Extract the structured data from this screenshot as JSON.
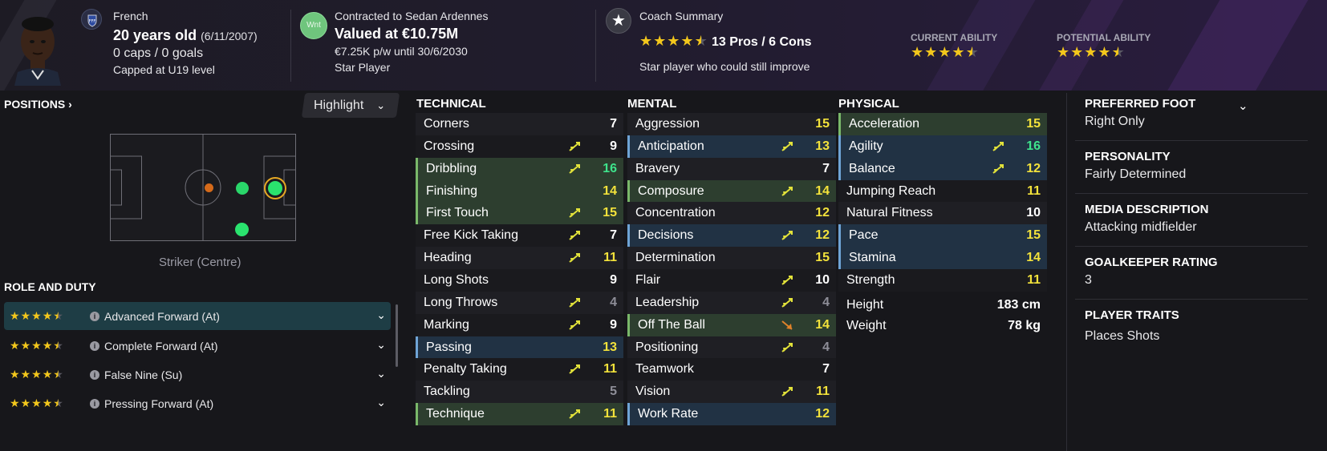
{
  "header": {
    "nationality": "French",
    "age_text": "20 years old",
    "dob": "(6/11/2007)",
    "caps_goals": "0 caps / 0 goals",
    "capped_level": "Capped at U19 level",
    "wnt_badge": "Wnt",
    "contract": "Contracted to Sedan Ardennes",
    "value": "Valued at €10.75M",
    "wage": "€7.25K p/w until 30/6/2030",
    "status": "Star Player",
    "coach_title": "Coach Summary",
    "pros_cons": "13 Pros / 6 Cons",
    "coach_stars": 4.5,
    "coach_note": "Star player who could still improve",
    "current_ability_label": "CURRENT ABILITY",
    "current_ability_stars": 4.5,
    "potential_ability_label": "POTENTIAL ABILITY",
    "potential_ability_stars": 4.5
  },
  "positions": {
    "title": "POSITIONS",
    "highlight_label": "Highlight",
    "position_name": "Striker (Centre)"
  },
  "role_duty": {
    "title": "ROLE AND DUTY",
    "roles": [
      {
        "label": "Advanced Forward (At)",
        "stars": 4.5
      },
      {
        "label": "Complete Forward (At)",
        "stars": 4.5
      },
      {
        "label": "False Nine (Su)",
        "stars": 4.5
      },
      {
        "label": "Pressing Forward (At)",
        "stars": 4.5
      }
    ]
  },
  "technical": {
    "title": "TECHNICAL",
    "attributes": [
      {
        "name": "Corners",
        "value": "7",
        "hl": "",
        "color": "white",
        "arrow": ""
      },
      {
        "name": "Crossing",
        "value": "9",
        "hl": "",
        "color": "white",
        "arrow": "up"
      },
      {
        "name": "Dribbling",
        "value": "16",
        "hl": "green",
        "color": "green",
        "arrow": "up"
      },
      {
        "name": "Finishing",
        "value": "14",
        "hl": "green",
        "color": "yellow",
        "arrow": ""
      },
      {
        "name": "First Touch",
        "value": "15",
        "hl": "green",
        "color": "yellow",
        "arrow": "up"
      },
      {
        "name": "Free Kick Taking",
        "value": "7",
        "hl": "",
        "color": "white",
        "arrow": "up"
      },
      {
        "name": "Heading",
        "value": "11",
        "hl": "",
        "color": "yellow",
        "arrow": "up"
      },
      {
        "name": "Long Shots",
        "value": "9",
        "hl": "",
        "color": "white",
        "arrow": ""
      },
      {
        "name": "Long Throws",
        "value": "4",
        "hl": "",
        "color": "grey",
        "arrow": "up"
      },
      {
        "name": "Marking",
        "value": "9",
        "hl": "",
        "color": "white",
        "arrow": "up"
      },
      {
        "name": "Passing",
        "value": "13",
        "hl": "blue",
        "color": "yellow",
        "arrow": ""
      },
      {
        "name": "Penalty Taking",
        "value": "11",
        "hl": "",
        "color": "yellow",
        "arrow": "up"
      },
      {
        "name": "Tackling",
        "value": "5",
        "hl": "",
        "color": "grey",
        "arrow": ""
      },
      {
        "name": "Technique",
        "value": "11",
        "hl": "green",
        "color": "yellow",
        "arrow": "up"
      }
    ]
  },
  "mental": {
    "title": "MENTAL",
    "attributes": [
      {
        "name": "Aggression",
        "value": "15",
        "hl": "",
        "color": "yellow",
        "arrow": ""
      },
      {
        "name": "Anticipation",
        "value": "13",
        "hl": "blue",
        "color": "yellow",
        "arrow": "up"
      },
      {
        "name": "Bravery",
        "value": "7",
        "hl": "",
        "color": "white",
        "arrow": ""
      },
      {
        "name": "Composure",
        "value": "14",
        "hl": "green",
        "color": "yellow",
        "arrow": "up"
      },
      {
        "name": "Concentration",
        "value": "12",
        "hl": "",
        "color": "yellow",
        "arrow": ""
      },
      {
        "name": "Decisions",
        "value": "12",
        "hl": "blue",
        "color": "yellow",
        "arrow": "up"
      },
      {
        "name": "Determination",
        "value": "15",
        "hl": "",
        "color": "yellow",
        "arrow": ""
      },
      {
        "name": "Flair",
        "value": "10",
        "hl": "",
        "color": "white",
        "arrow": "up"
      },
      {
        "name": "Leadership",
        "value": "4",
        "hl": "",
        "color": "grey",
        "arrow": "up"
      },
      {
        "name": "Off The Ball",
        "value": "14",
        "hl": "green",
        "color": "yellow",
        "arrow": "orange"
      },
      {
        "name": "Positioning",
        "value": "4",
        "hl": "",
        "color": "grey",
        "arrow": "up"
      },
      {
        "name": "Teamwork",
        "value": "7",
        "hl": "",
        "color": "white",
        "arrow": ""
      },
      {
        "name": "Vision",
        "value": "11",
        "hl": "",
        "color": "yellow",
        "arrow": "up"
      },
      {
        "name": "Work Rate",
        "value": "12",
        "hl": "blue",
        "color": "yellow",
        "arrow": ""
      }
    ]
  },
  "physical": {
    "title": "PHYSICAL",
    "attributes": [
      {
        "name": "Acceleration",
        "value": "15",
        "hl": "green",
        "color": "yellow",
        "arrow": ""
      },
      {
        "name": "Agility",
        "value": "16",
        "hl": "blue",
        "color": "green",
        "arrow": "up"
      },
      {
        "name": "Balance",
        "value": "12",
        "hl": "blue",
        "color": "yellow",
        "arrow": "up"
      },
      {
        "name": "Jumping Reach",
        "value": "11",
        "hl": "",
        "color": "yellow",
        "arrow": ""
      },
      {
        "name": "Natural Fitness",
        "value": "10",
        "hl": "",
        "color": "white",
        "arrow": ""
      },
      {
        "name": "Pace",
        "value": "15",
        "hl": "blue",
        "color": "yellow",
        "arrow": ""
      },
      {
        "name": "Stamina",
        "value": "14",
        "hl": "blue",
        "color": "yellow",
        "arrow": ""
      },
      {
        "name": "Strength",
        "value": "11",
        "hl": "",
        "color": "yellow",
        "arrow": ""
      }
    ],
    "height_label": "Height",
    "height_value": "183 cm",
    "weight_label": "Weight",
    "weight_value": "78 kg"
  },
  "info_panel": {
    "preferred_foot_label": "PREFERRED FOOT",
    "preferred_foot": "Right Only",
    "personality_label": "PERSONALITY",
    "personality": "Fairly Determined",
    "media_label": "MEDIA DESCRIPTION",
    "media": "Attacking midfielder",
    "gk_label": "GOALKEEPER RATING",
    "gk": "3",
    "traits_label": "PLAYER TRAITS",
    "traits": "Places Shots"
  },
  "colors": {
    "yellow": "#f3e23b",
    "green": "#3ee38b",
    "star": "#f3c71c",
    "highlight_green": "#2d3e2f",
    "highlight_blue": "#213244"
  }
}
